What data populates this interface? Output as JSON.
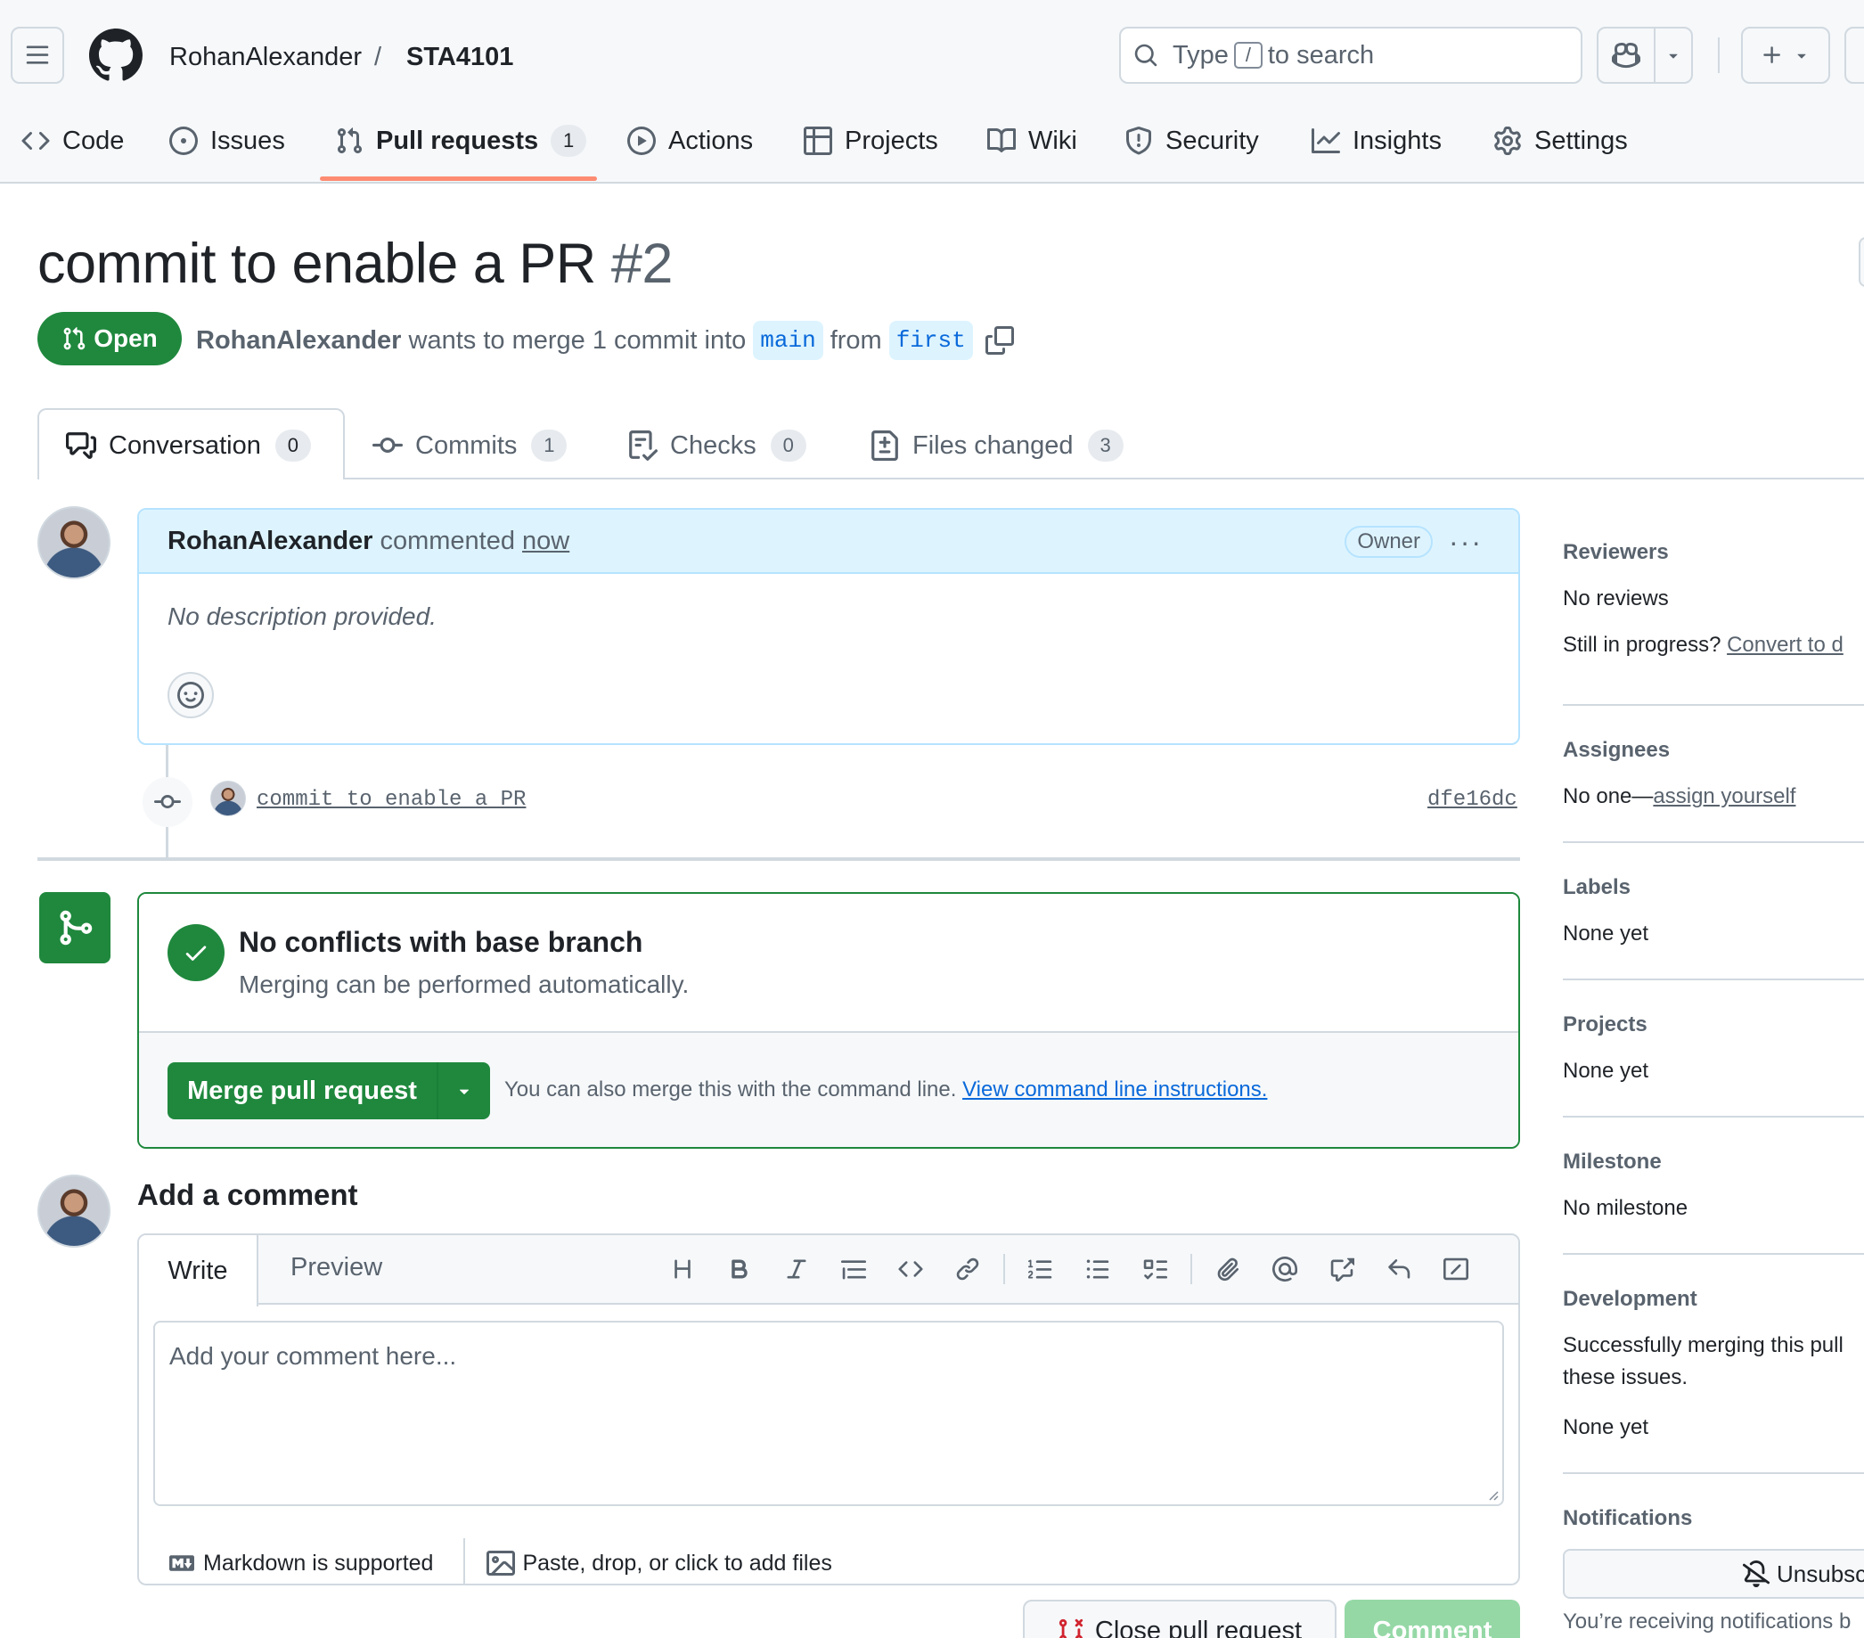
{
  "header": {
    "owner": "RohanAlexander",
    "separator": "/",
    "repo": "STA4101",
    "search": {
      "prefix": "Type",
      "key": "/",
      "suffix": "to search"
    }
  },
  "nav": {
    "tabs": [
      {
        "label": "Code",
        "icon": "code-icon"
      },
      {
        "label": "Issues",
        "icon": "issue-icon"
      },
      {
        "label": "Pull requests",
        "icon": "pull-request-icon",
        "count": "1",
        "active": true
      },
      {
        "label": "Actions",
        "icon": "play-icon"
      },
      {
        "label": "Projects",
        "icon": "table-icon"
      },
      {
        "label": "Wiki",
        "icon": "book-icon"
      },
      {
        "label": "Security",
        "icon": "shield-icon"
      },
      {
        "label": "Insights",
        "icon": "graph-icon"
      },
      {
        "label": "Settings",
        "icon": "gear-icon"
      }
    ]
  },
  "pr": {
    "title": "commit to enable a PR",
    "number": "#2",
    "state": "Open",
    "author": "RohanAlexander",
    "summary": "wants to merge 1 commit into",
    "base": "main",
    "from_word": "from",
    "head": "first"
  },
  "pr_tabs": {
    "conversation": {
      "label": "Conversation",
      "count": "0"
    },
    "commits": {
      "label": "Commits",
      "count": "1"
    },
    "checks": {
      "label": "Checks",
      "count": "0"
    },
    "files": {
      "label": "Files changed",
      "count": "3"
    }
  },
  "comment": {
    "author": "RohanAlexander",
    "action": "commented",
    "time": "now",
    "badge": "Owner",
    "more": "···",
    "body": "No description provided."
  },
  "commit": {
    "message": "commit to enable a PR",
    "sha": "dfe16dc"
  },
  "merge": {
    "heading": "No conflicts with base branch",
    "subtext": "Merging can be performed automatically.",
    "button": "Merge pull request",
    "hint": "You can also merge this with the command line.",
    "hint_link": "View command line instructions."
  },
  "add_comment": {
    "title": "Add a comment",
    "tab_write": "Write",
    "tab_preview": "Preview",
    "placeholder": "Add your comment here...",
    "markdown": "Markdown is supported",
    "files": "Paste, drop, or click to add files",
    "close_button": "Close pull request",
    "comment_button": "Comment"
  },
  "sidebar": {
    "reviewers": {
      "title": "Reviewers",
      "value": "No reviews",
      "progress_text": "Still in progress?",
      "progress_link": "Convert to d"
    },
    "assignees": {
      "title": "Assignees",
      "value": "No one—",
      "link": "assign yourself"
    },
    "labels": {
      "title": "Labels",
      "value": "None yet"
    },
    "projects": {
      "title": "Projects",
      "value": "None yet"
    },
    "milestone": {
      "title": "Milestone",
      "value": "No milestone"
    },
    "development": {
      "title": "Development",
      "line1": "Successfully merging this pull",
      "line2": "these issues.",
      "value": "None yet"
    },
    "notifications": {
      "title": "Notifications",
      "button": "Unsubsc",
      "text": "You’re receiving notifications b"
    }
  },
  "colors": {
    "accent_green": "#1f883d",
    "link_blue": "#0969da",
    "tab_underline": "#fd8c73",
    "comment_header": "#ddf4ff"
  }
}
